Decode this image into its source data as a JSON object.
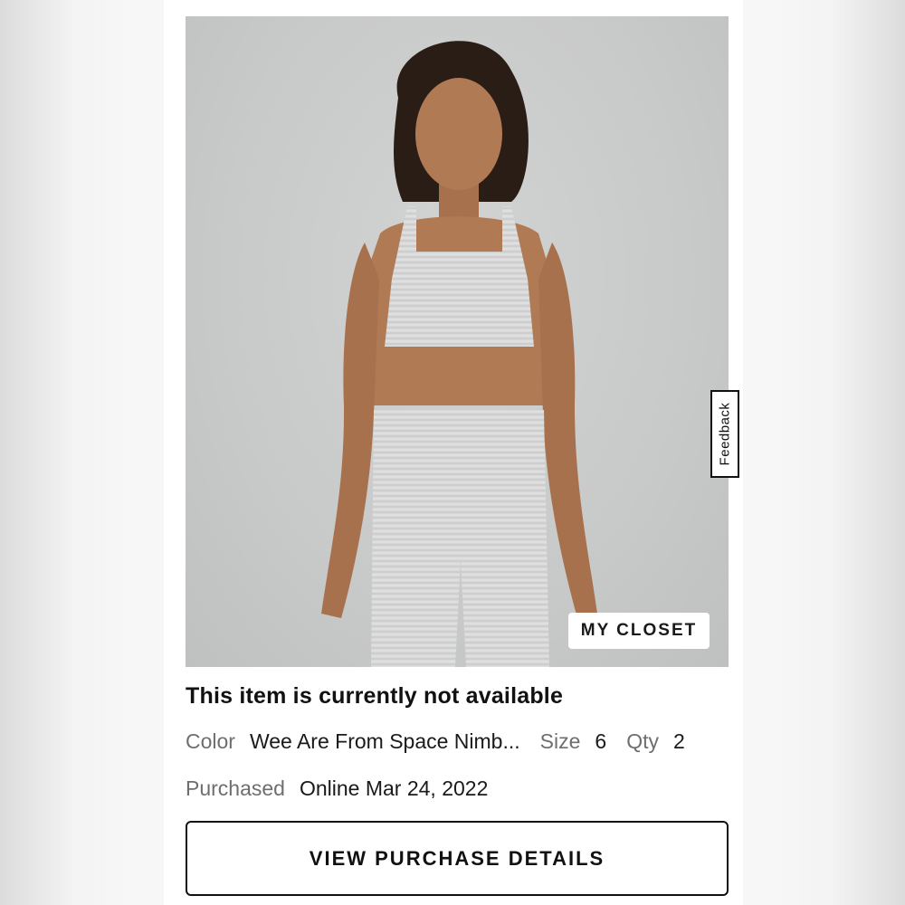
{
  "product": {
    "image_alt": "Model wearing light grey heathered sports bra and leggings",
    "badge_label": "MY CLOSET",
    "status_text": "This item is currently not available"
  },
  "details": {
    "color_label": "Color",
    "color_value": "Wee Are From Space Nimb...",
    "size_label": "Size",
    "size_value": "6",
    "qty_label": "Qty",
    "qty_value": "2",
    "purchased_label": "Purchased",
    "purchased_value": "Online Mar 24, 2022"
  },
  "actions": {
    "view_details_label": "VIEW PURCHASE DETAILS"
  },
  "feedback": {
    "label": "Feedback"
  },
  "colors": {
    "photo_bg": "#c8c9c9",
    "garment": "#d9d9d9",
    "skin": "#b07a55",
    "hair": "#2a1d16"
  }
}
